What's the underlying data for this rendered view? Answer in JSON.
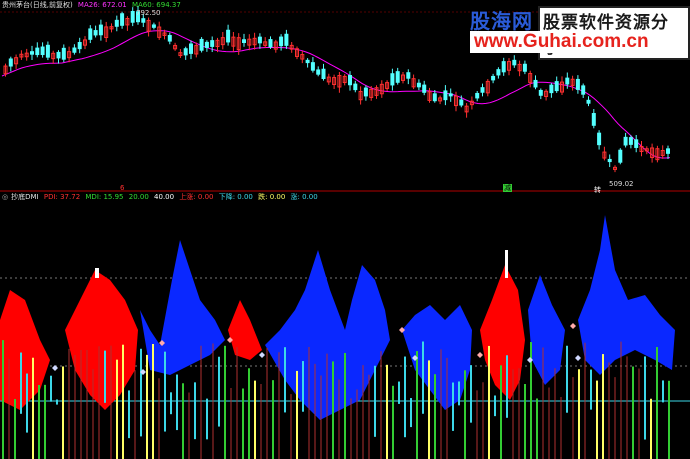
{
  "top_panel": {
    "title": "贵州茅台(日线,前复权)",
    "ma26_label": "MA26: 672.01",
    "ma60_label": "MA60: 694.37",
    "high_label": "792.50",
    "low_label": "509.02",
    "bottom_markers": [
      "6",
      "减",
      "转"
    ],
    "colors": {
      "up": "#ff3030",
      "down": "#54ffff",
      "ma26": "#ff00ff",
      "ma60": "#00c800"
    }
  },
  "bottom_panel": {
    "title": "抄底DMI",
    "pdi_label": "PDI: 37.72",
    "mdi_label": "MDI: 15.95",
    "v1_label": "20.00",
    "v2_label": "40.00",
    "up_label": "上涨: 0.00",
    "down_label": "下降: 0.00",
    "fall_label": "跌: 0.00",
    "rise_label": "涨: 0.00",
    "colors": {
      "red": "#ff0000",
      "blue": "#0a28ff",
      "yellow": "#ffff66",
      "cyan": "#3cd8e8",
      "green": "#33cc33"
    }
  },
  "watermark": {
    "brand": "股海网",
    "slogan": "股票软件资源分享",
    "url": "www.Guhai.com.cn"
  }
}
